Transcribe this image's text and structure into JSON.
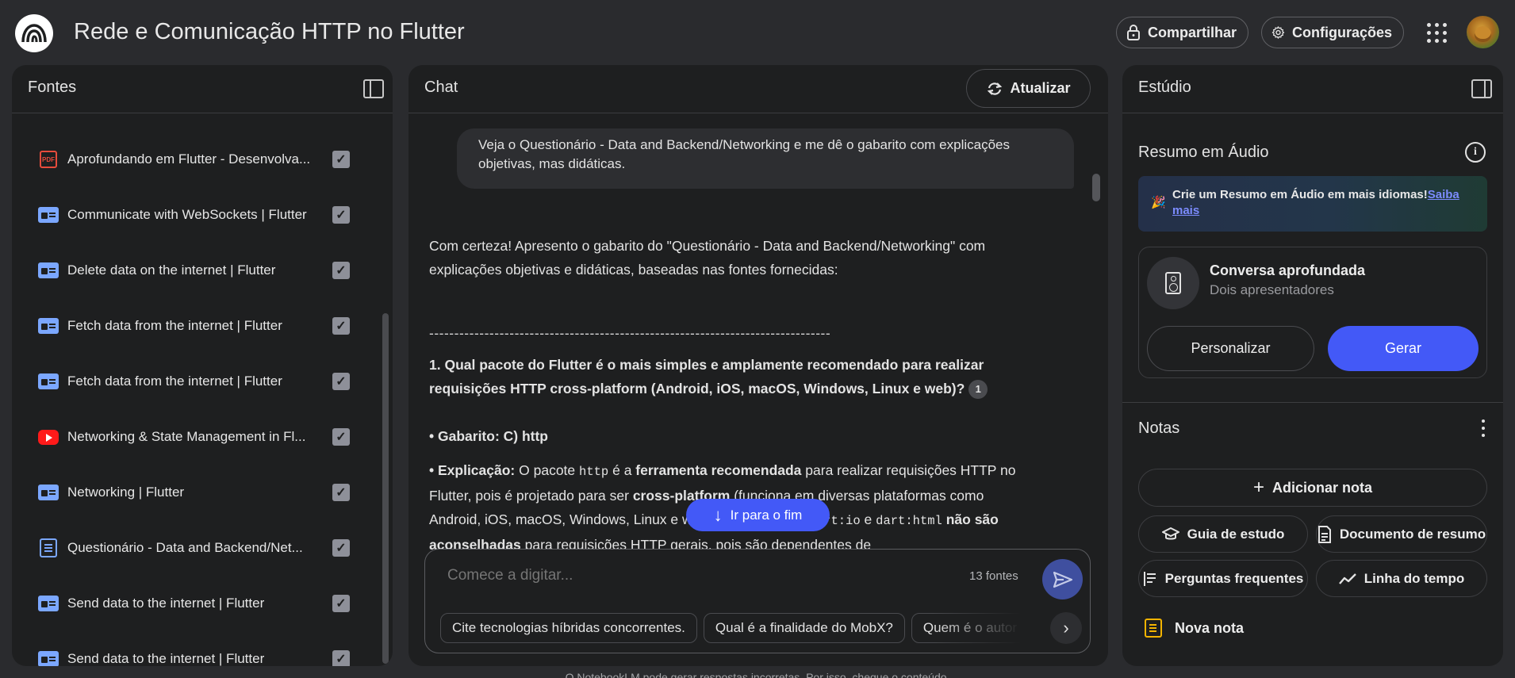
{
  "header": {
    "title": "Rede e Comunicação HTTP no Flutter",
    "share_label": "Compartilhar",
    "settings_label": "Configurações"
  },
  "sources": {
    "title": "Fontes",
    "items": [
      {
        "label": "Aprofundando em Flutter - Desenvolva...",
        "icon": "pdf-icon",
        "checked": true
      },
      {
        "label": "Communicate with WebSockets | Flutter",
        "icon": "web-icon",
        "checked": true
      },
      {
        "label": "Delete data on the internet | Flutter",
        "icon": "web-icon",
        "checked": true
      },
      {
        "label": "Fetch data from the internet | Flutter",
        "icon": "web-icon",
        "checked": true
      },
      {
        "label": "Fetch data from the internet | Flutter",
        "icon": "web-icon",
        "checked": true
      },
      {
        "label": "Networking & State Management in Fl...",
        "icon": "youtube-icon",
        "checked": true
      },
      {
        "label": "Networking | Flutter",
        "icon": "web-icon",
        "checked": true
      },
      {
        "label": "Questionário - Data and Backend/Net...",
        "icon": "document-icon",
        "checked": true
      },
      {
        "label": "Send data to the internet | Flutter",
        "icon": "web-icon",
        "checked": true
      },
      {
        "label": "Send data to the internet | Flutter",
        "icon": "web-icon",
        "checked": true
      }
    ]
  },
  "chat": {
    "title": "Chat",
    "refresh_label": "Atualizar",
    "user_message": "Veja o Questionário - Data and Backend/Networking e me dê o gabarito com explicações objetivas, mas didáticas.",
    "answer": {
      "intro": "Com certeza! Apresento o gabarito do \"Questionário - Data and Backend/Networking\" com explicações objetivas e didáticas, baseadas nas fontes fornecidas:",
      "separator": "--------------------------------------------------------------------------------",
      "q1": "1. Qual pacote do Flutter é o mais simples e amplamente recomendado para realizar requisições HTTP cross-platform (Android, iOS, macOS, Windows, Linux e web)?",
      "q1_citation": "1",
      "answer_bullet": "• Gabarito: C) http",
      "expl_label": "• Explicação:",
      "expl_1": " O pacote ",
      "expl_code_http": "http",
      "expl_2": " é a ",
      "expl_bold_1": "ferramenta recomendada",
      "expl_3": " para realizar requisições HTTP no Flutter, pois é projetado para ser ",
      "expl_bold_2": "cross-platform",
      "expl_4": " (funciona em diversas plataformas como Android, iOS, macOS, Windows, Linux e web). As bibliotecas ",
      "expl_code_io": "dart:io",
      "expl_5": " e ",
      "expl_code_html": "dart:html",
      "expl_bold_3": " não são aconselhadas",
      "expl_6": " para requisições HTTP gerais, pois são dependentes de"
    },
    "jump_label": "Ir para o fim",
    "input_placeholder": "Comece a digitar...",
    "source_count": "13 fontes",
    "suggestions": [
      "Cite tecnologias híbridas concorrentes.",
      "Qual é a finalidade do MobX?",
      "Quem é o autor"
    ],
    "footer_note": "O NotebookLM pode gerar respostas incorretas. Por isso, cheque o conteúdo."
  },
  "studio": {
    "title": "Estúdio",
    "audio_title": "Resumo em Áudio",
    "banner_text": "Crie um Resumo em Áudio em mais idiomas!",
    "banner_link": "Saiba mais",
    "card_title": "Conversa aprofundada",
    "card_subtitle": "Dois apresentadores",
    "customize_label": "Personalizar",
    "generate_label": "Gerar",
    "notes_title": "Notas",
    "add_note_label": "Adicionar nota",
    "study_guide_label": "Guia de estudo",
    "summary_doc_label": "Documento de resumo",
    "faq_label": "Perguntas frequentes",
    "timeline_label": "Linha do tempo",
    "new_note_label": "Nova nota"
  },
  "colors": {
    "accent": "#4359f7",
    "background": "#2a2b2e",
    "panel": "#1e1f20"
  }
}
